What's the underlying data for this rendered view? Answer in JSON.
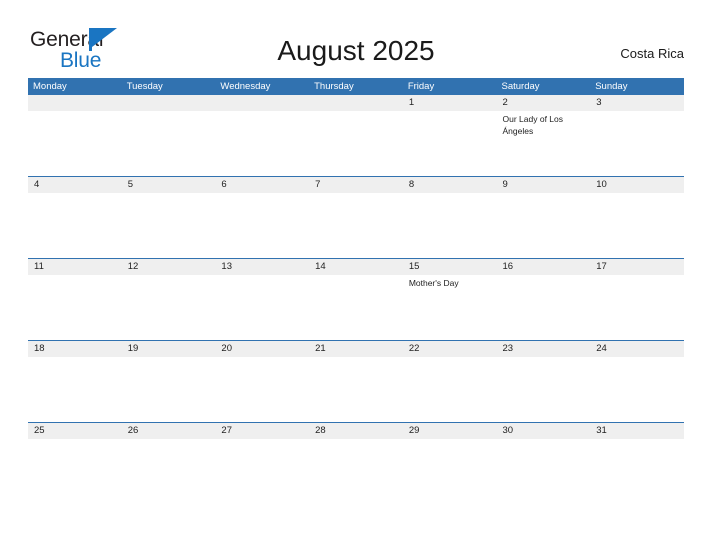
{
  "brand": {
    "name_top": "General",
    "name_bottom": "Blue",
    "flag_icon": "blue-flag-icon",
    "color_text": "#231f20",
    "color_accent": "#1a75c2"
  },
  "header": {
    "title": "August 2025",
    "region": "Costa Rica"
  },
  "calendar": {
    "accent_color": "#3172b0",
    "daynum_band_color": "#efefef",
    "weekdays": [
      "Monday",
      "Tuesday",
      "Wednesday",
      "Thursday",
      "Friday",
      "Saturday",
      "Sunday"
    ],
    "weeks": [
      {
        "days": [
          {
            "num": "",
            "event": ""
          },
          {
            "num": "",
            "event": ""
          },
          {
            "num": "",
            "event": ""
          },
          {
            "num": "",
            "event": ""
          },
          {
            "num": "1",
            "event": ""
          },
          {
            "num": "2",
            "event": "Our Lady of Los Ángeles"
          },
          {
            "num": "3",
            "event": ""
          }
        ]
      },
      {
        "days": [
          {
            "num": "4",
            "event": ""
          },
          {
            "num": "5",
            "event": ""
          },
          {
            "num": "6",
            "event": ""
          },
          {
            "num": "7",
            "event": ""
          },
          {
            "num": "8",
            "event": ""
          },
          {
            "num": "9",
            "event": ""
          },
          {
            "num": "10",
            "event": ""
          }
        ]
      },
      {
        "days": [
          {
            "num": "11",
            "event": ""
          },
          {
            "num": "12",
            "event": ""
          },
          {
            "num": "13",
            "event": ""
          },
          {
            "num": "14",
            "event": ""
          },
          {
            "num": "15",
            "event": "Mother's Day"
          },
          {
            "num": "16",
            "event": ""
          },
          {
            "num": "17",
            "event": ""
          }
        ]
      },
      {
        "days": [
          {
            "num": "18",
            "event": ""
          },
          {
            "num": "19",
            "event": ""
          },
          {
            "num": "20",
            "event": ""
          },
          {
            "num": "21",
            "event": ""
          },
          {
            "num": "22",
            "event": ""
          },
          {
            "num": "23",
            "event": ""
          },
          {
            "num": "24",
            "event": ""
          }
        ]
      },
      {
        "days": [
          {
            "num": "25",
            "event": ""
          },
          {
            "num": "26",
            "event": ""
          },
          {
            "num": "27",
            "event": ""
          },
          {
            "num": "28",
            "event": ""
          },
          {
            "num": "29",
            "event": ""
          },
          {
            "num": "30",
            "event": ""
          },
          {
            "num": "31",
            "event": ""
          }
        ]
      }
    ]
  }
}
